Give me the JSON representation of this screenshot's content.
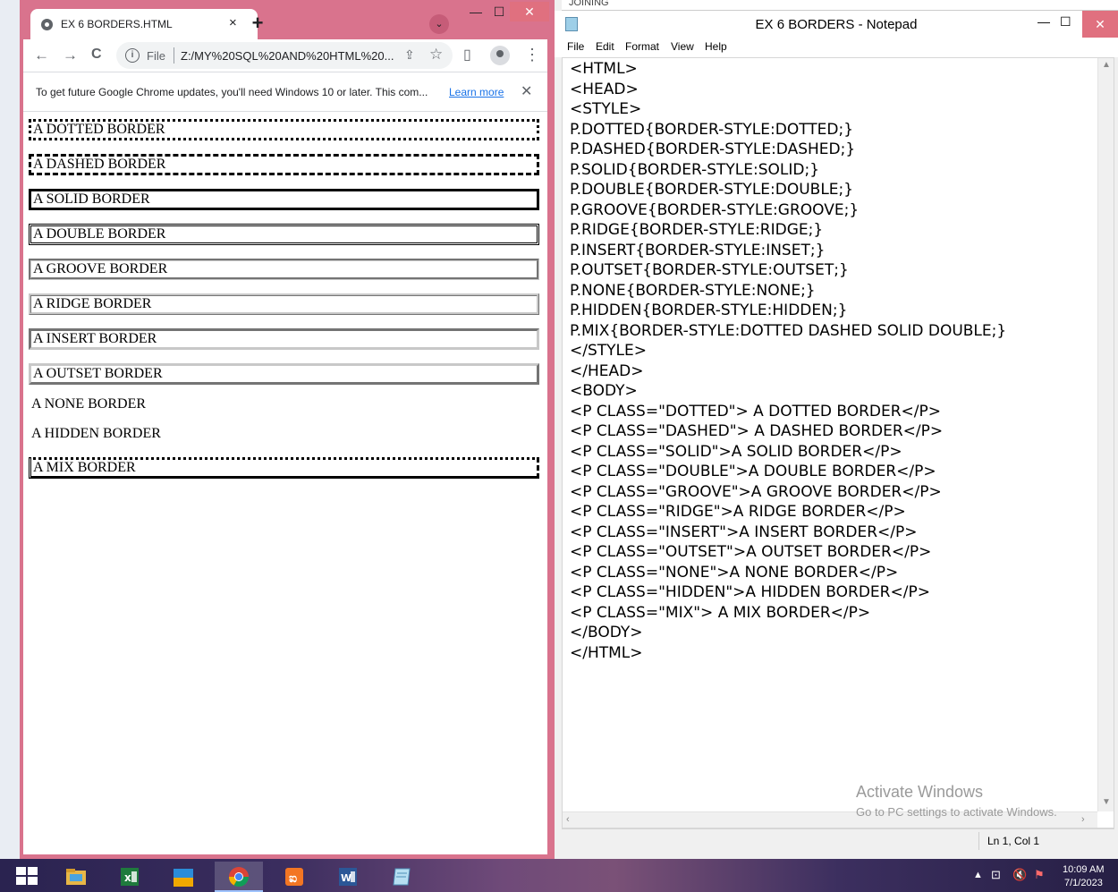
{
  "chrome": {
    "tab_title": "EX 6 BORDERS.HTML",
    "tab_close": "×",
    "new_tab": "+",
    "tab_search": "⌄",
    "minimize": "—",
    "maximize": "☐",
    "close": "✕",
    "back": "←",
    "forward": "→",
    "reload": "C",
    "url_protocol": "File",
    "url": "Z:/MY%20SQL%20AND%20HTML%20...",
    "info_icon": "i",
    "infobar_text": "To get future Google Chrome updates, you'll need Windows 10 or later. This com...",
    "infobar_link": "Learn more",
    "infobar_close": "✕",
    "menu_icon": "⋮"
  },
  "page": {
    "paragraphs": [
      {
        "text": "A DOTTED BORDER",
        "style": "dotted"
      },
      {
        "text": "A DASHED BORDER",
        "style": "dashed"
      },
      {
        "text": "A SOLID BORDER",
        "style": "solid"
      },
      {
        "text": "A DOUBLE BORDER",
        "style": "double"
      },
      {
        "text": "A GROOVE BORDER",
        "style": "groove"
      },
      {
        "text": "A RIDGE BORDER",
        "style": "ridge"
      },
      {
        "text": "A INSERT BORDER",
        "style": "inset"
      },
      {
        "text": "A OUTSET BORDER",
        "style": "outset"
      },
      {
        "text": "A NONE BORDER",
        "style": "none"
      },
      {
        "text": "A HIDDEN BORDER",
        "style": "hidden"
      },
      {
        "text": "A MIX BORDER",
        "style": "mix"
      }
    ]
  },
  "notepad": {
    "behind_title": "JOINING",
    "title": "EX 6 BORDERS - Notepad",
    "minimize": "—",
    "maximize": "☐",
    "close": "✕",
    "menu": [
      "File",
      "Edit",
      "Format",
      "View",
      "Help"
    ],
    "code_lines": [
      "<HTML>",
      "<HEAD>",
      "<STYLE>",
      "P.DOTTED{BORDER-STYLE:DOTTED;}",
      "P.DASHED{BORDER-STYLE:DASHED;}",
      "P.SOLID{BORDER-STYLE:SOLID;}",
      "P.DOUBLE{BORDER-STYLE:DOUBLE;}",
      "P.GROOVE{BORDER-STYLE:GROOVE;}",
      "P.RIDGE{BORDER-STYLE:RIDGE;}",
      "P.INSERT{BORDER-STYLE:INSET;}",
      "P.OUTSET{BORDER-STYLE:OUTSET;}",
      "P.NONE{BORDER-STYLE:NONE;}",
      "P.HIDDEN{BORDER-STYLE:HIDDEN;}",
      "P.MIX{BORDER-STYLE:DOTTED DASHED SOLID DOUBLE;}",
      "</STYLE>",
      "</HEAD>",
      "<BODY>",
      "<P CLASS=\"DOTTED\"> A DOTTED BORDER</P>",
      "<P CLASS=\"DASHED\"> A DASHED BORDER</P>",
      "<P CLASS=\"SOLID\">A SOLID BORDER</P>",
      "<P CLASS=\"DOUBLE\">A DOUBLE BORDER</P>",
      "<P CLASS=\"GROOVE\">A GROOVE BORDER</P>",
      "<P CLASS=\"RIDGE\">A RIDGE BORDER</P>",
      "<P CLASS=\"INSERT\">A INSERT BORDER</P>",
      "<P CLASS=\"OUTSET\">A OUTSET BORDER</P>",
      "<P CLASS=\"NONE\">A NONE BORDER</P>",
      "<P CLASS=\"HIDDEN\">A HIDDEN BORDER</P>",
      "<P CLASS=\"MIX\"> A MIX BORDER</P>",
      "</BODY>",
      "</HTML>"
    ],
    "watermark_title": "Activate Windows",
    "watermark_sub": "Go to PC settings to activate Windows.",
    "status_position": "Ln 1, Col 1"
  },
  "taskbar": {
    "apps": [
      "file-explorer-icon",
      "excel-icon",
      "store-icon",
      "chrome-icon",
      "xampp-icon",
      "word-icon",
      "notepad-icon"
    ],
    "time": "10:09 AM",
    "date": "7/1/2023"
  },
  "colors": {
    "chrome_frame": "#d9738d",
    "close_button": "#e0707f",
    "link": "#1a73e8"
  }
}
